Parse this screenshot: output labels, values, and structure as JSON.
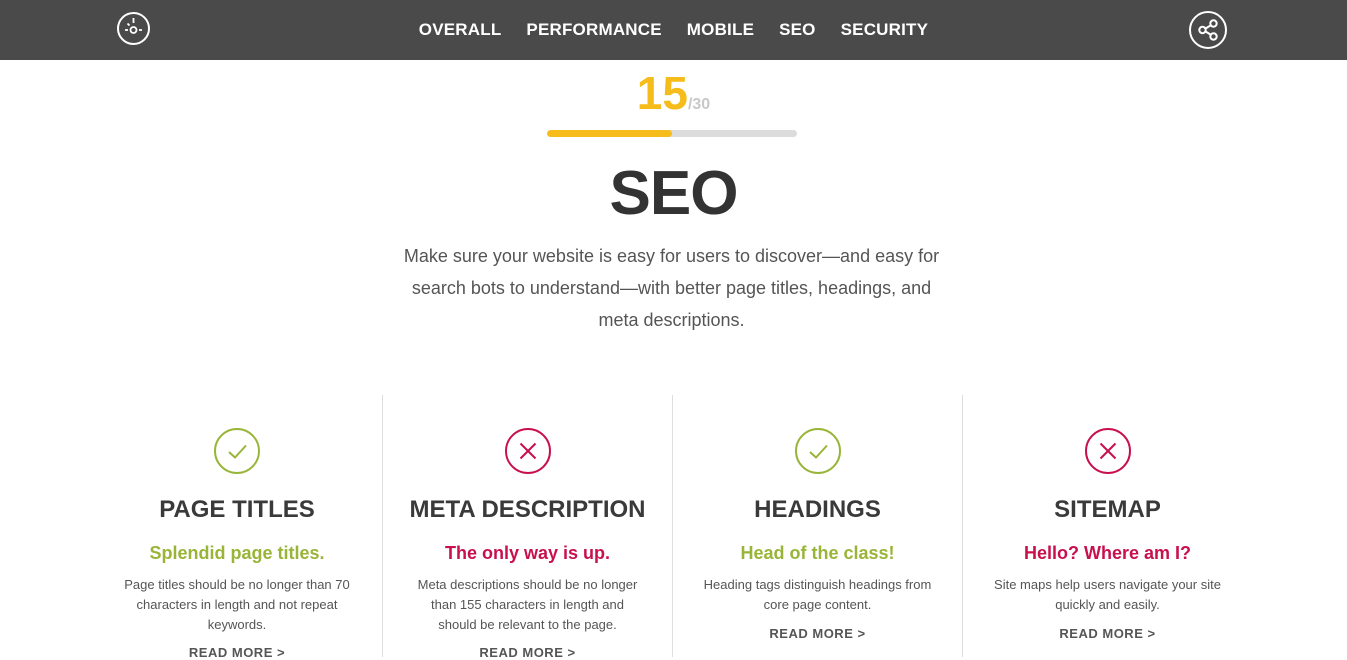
{
  "nav": {
    "items": [
      "OVERALL",
      "PERFORMANCE",
      "MOBILE",
      "SEO",
      "SECURITY"
    ],
    "logo_icon": "speedometer-icon",
    "share_icon": "share-icon"
  },
  "score": {
    "value": "15",
    "max": "/30",
    "progress_fraction": 0.5
  },
  "section": {
    "title": "SEO",
    "description": "Make sure your website is easy for users to discover—and easy for search bots to understand—with better page titles, headings, and meta descriptions."
  },
  "colors": {
    "pass": "#99b538",
    "fail": "#c8104d",
    "accent": "#f5bc1c",
    "topbar": "#4a4a4a"
  },
  "cards": [
    {
      "status": "pass",
      "icon": "check-circle-icon",
      "title": "PAGE TITLES",
      "subtitle": "Splendid page titles.",
      "text": "Page titles should be no longer than 70 characters in length and not repeat keywords.",
      "more": "READ MORE >"
    },
    {
      "status": "fail",
      "icon": "x-circle-icon",
      "title": "META DESCRIPTION",
      "subtitle": "The only way is up.",
      "text": "Meta descriptions should be no longer than 155 characters in length and should be relevant to the page.",
      "more": "READ MORE >"
    },
    {
      "status": "pass",
      "icon": "check-circle-icon",
      "title": "HEADINGS",
      "subtitle": "Head of the class!",
      "text": "Heading tags distinguish headings from core page content.",
      "more": "READ MORE >"
    },
    {
      "status": "fail",
      "icon": "x-circle-icon",
      "title": "SITEMAP",
      "subtitle": "Hello? Where am I?",
      "text": "Site maps help users navigate your site quickly and easily.",
      "more": "READ MORE >"
    }
  ]
}
